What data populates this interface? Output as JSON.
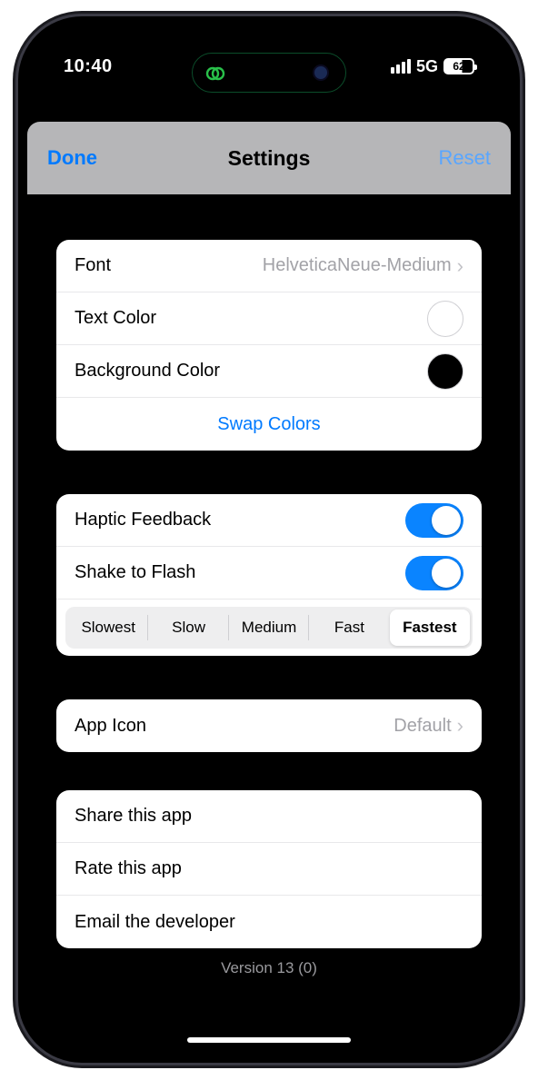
{
  "status": {
    "time": "10:40",
    "network": "5G",
    "battery_pct": "62"
  },
  "nav": {
    "title": "Settings",
    "done": "Done",
    "reset": "Reset"
  },
  "appearance": {
    "font_label": "Font",
    "font_value": "HelveticaNeue-Medium",
    "text_color_label": "Text Color",
    "text_color": "#FFFFFF",
    "bg_color_label": "Background Color",
    "bg_color": "#000000",
    "swap": "Swap Colors"
  },
  "behaviors": {
    "haptic_label": "Haptic Feedback",
    "haptic_on": true,
    "shake_label": "Shake to Flash",
    "shake_on": true,
    "speed_options": [
      "Slowest",
      "Slow",
      "Medium",
      "Fast",
      "Fastest"
    ],
    "speed_selected": "Fastest"
  },
  "appicon": {
    "label": "App Icon",
    "value": "Default"
  },
  "links": {
    "share": "Share this app",
    "rate": "Rate this app",
    "email": "Email the developer"
  },
  "version": "Version 13 (0)"
}
